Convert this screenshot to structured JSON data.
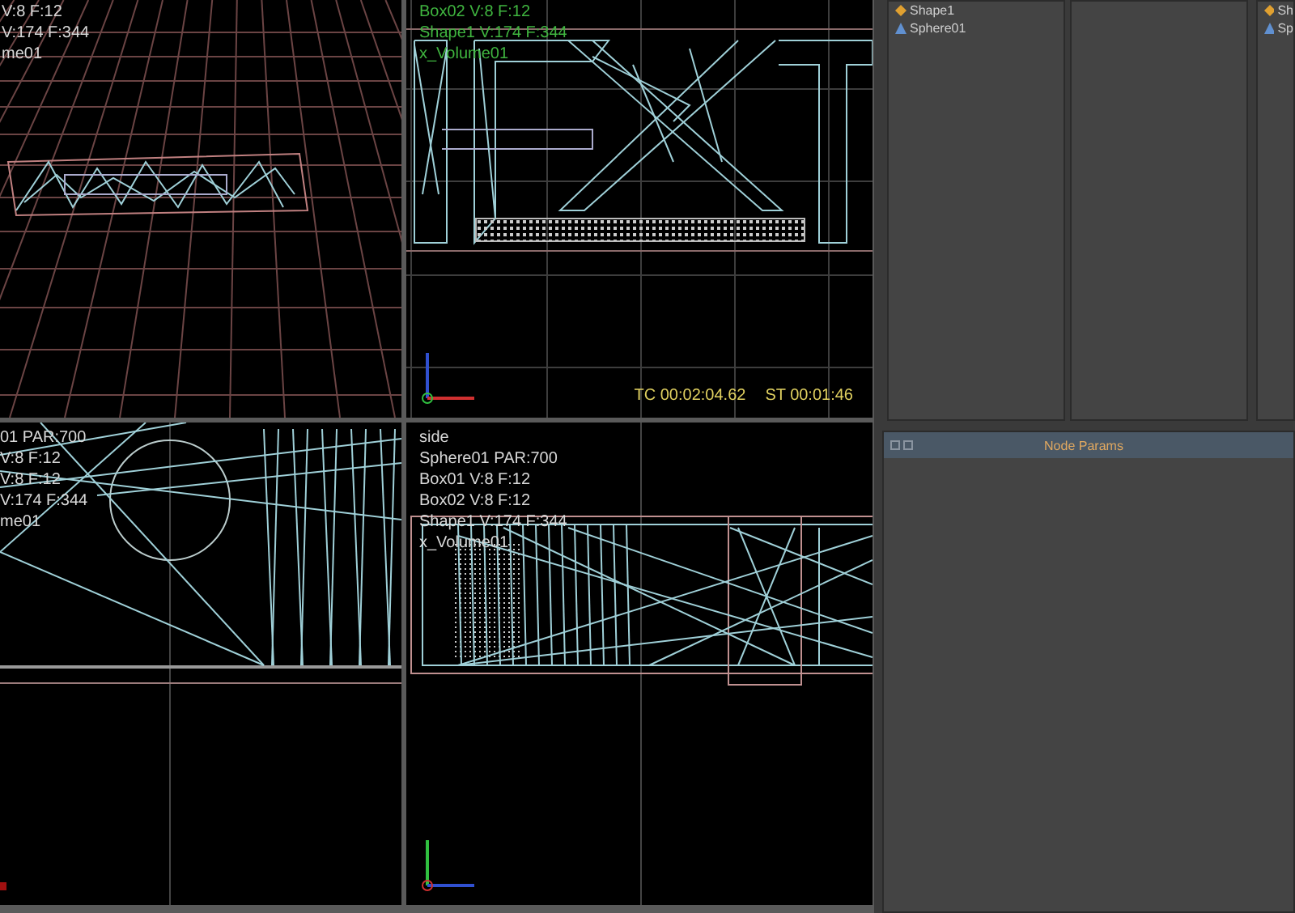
{
  "viewports": [
    {
      "kind": "perspective",
      "selected": false,
      "labels": [
        "V:8 F:12",
        "V:174 F:344",
        "me01"
      ]
    },
    {
      "kind": "front",
      "selected": true,
      "labels": [
        "Box02 V:8 F:12",
        "Shape1 V:174 F:344",
        "x_Volume01"
      ],
      "timecode": [
        "TC 00:02:04.62",
        "ST 00:01:46"
      ]
    },
    {
      "kind": "top",
      "selected": false,
      "labels": [
        "01 PAR:700",
        "V:8 F:12",
        "V:8 F:12",
        "V:174 F:344",
        "me01"
      ]
    },
    {
      "kind": "side",
      "selected": false,
      "labels": [
        "side",
        "Sphere01 PAR:700",
        "Box01 V:8 F:12",
        "Box02 V:8 F:12",
        "Shape1 V:174 F:344",
        "x_Volume01"
      ]
    }
  ],
  "outliner_columns": [
    {
      "items": [
        {
          "label": "Shape1",
          "kind": "shape"
        },
        {
          "label": "Sphere01",
          "kind": "emitter"
        }
      ]
    },
    {},
    {
      "items": [
        {
          "label": "Sh",
          "kind": "shape"
        },
        {
          "label": "Sp",
          "kind": "emitter"
        }
      ]
    }
  ],
  "node_params": {
    "title": "Node Params"
  }
}
